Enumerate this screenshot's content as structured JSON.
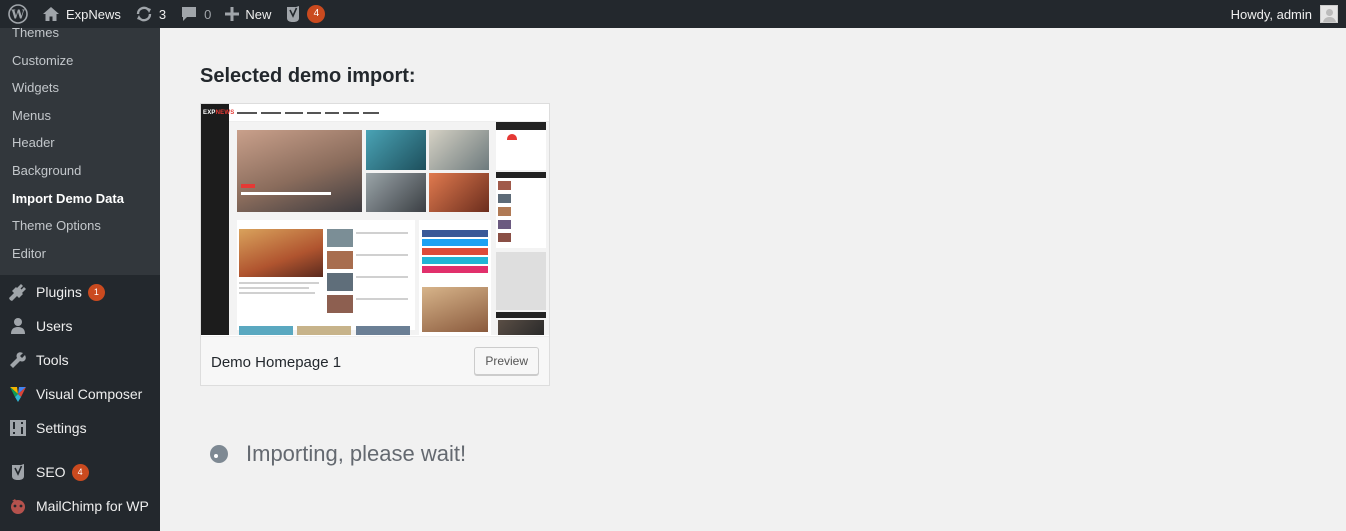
{
  "adminbar": {
    "site_name": "ExpNews",
    "updates_count": "3",
    "comments_count": "0",
    "new_label": "New",
    "seo_badge": "4",
    "howdy": "Howdy, admin"
  },
  "sidebar": {
    "submenu": [
      {
        "label": "Themes"
      },
      {
        "label": "Customize"
      },
      {
        "label": "Widgets"
      },
      {
        "label": "Menus"
      },
      {
        "label": "Header"
      },
      {
        "label": "Background"
      },
      {
        "label": "Import Demo Data"
      },
      {
        "label": "Theme Options"
      },
      {
        "label": "Editor"
      }
    ],
    "menu": [
      {
        "label": "Plugins",
        "badge": "1",
        "icon": "plugin-icon"
      },
      {
        "label": "Users",
        "icon": "users-icon"
      },
      {
        "label": "Tools",
        "icon": "wrench-icon"
      },
      {
        "label": "Visual Composer",
        "icon": "visual-composer-icon"
      },
      {
        "label": "Settings",
        "icon": "settings-icon"
      },
      {
        "label": "SEO",
        "badge": "4",
        "icon": "yoast-icon"
      },
      {
        "label": "MailChimp for WP",
        "icon": "mailchimp-icon"
      }
    ]
  },
  "main": {
    "heading": "Selected demo import:",
    "demo": {
      "name": "Demo Homepage 1",
      "preview_label": "Preview"
    },
    "status": "Importing, please wait!"
  },
  "colors": {
    "adminbar_bg": "#23282d",
    "badge": "#ca4a1f",
    "content_bg": "#f1f1f1"
  }
}
